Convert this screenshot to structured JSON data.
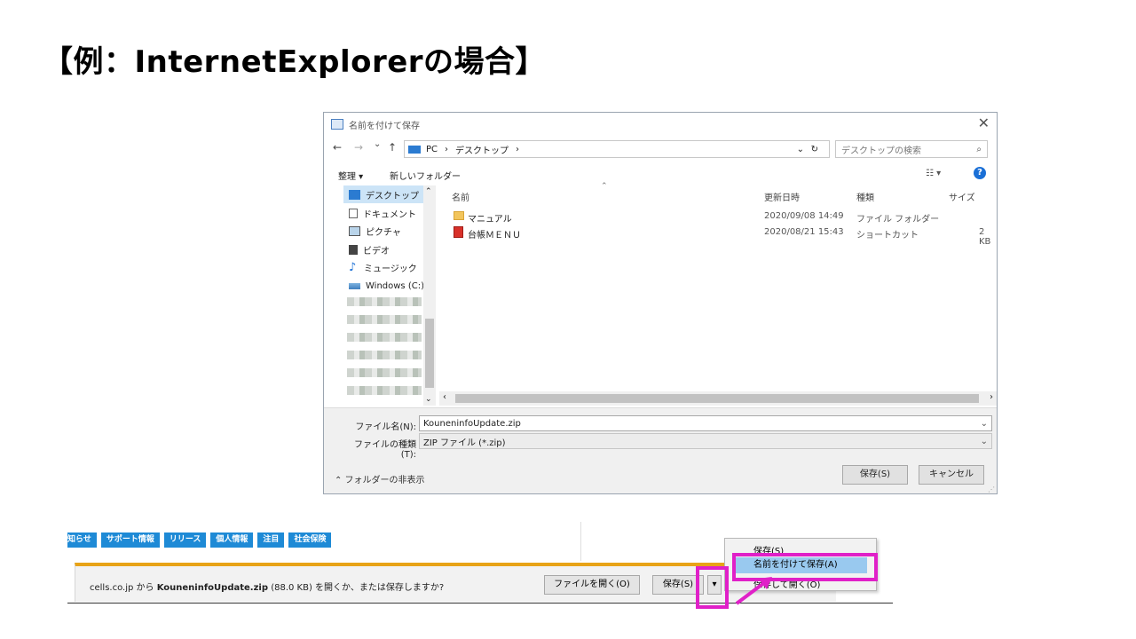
{
  "slide": {
    "title": "【例：InternetExplorerの場合】"
  },
  "dialog": {
    "title": "名前を付けて保存",
    "close": "✕",
    "nav": {
      "back": "←",
      "forward": "→",
      "recent": "⌄",
      "up": "↑",
      "path": [
        "PC",
        "›",
        "デスクトップ",
        "›"
      ],
      "path_dropdown": "⌄",
      "refresh": "↻",
      "search_placeholder": "デスクトップの検索",
      "search_icon": "⌕"
    },
    "toolbar": {
      "organize": "整理 ▾",
      "new_folder": "新しいフォルダー",
      "view": "☷ ▾",
      "help": "?"
    },
    "sidebar": [
      {
        "label": "デスクトップ",
        "icon": "desktop-icon"
      },
      {
        "label": "ドキュメント",
        "icon": "document-icon"
      },
      {
        "label": "ピクチャ",
        "icon": "picture-icon"
      },
      {
        "label": "ビデオ",
        "icon": "video-icon"
      },
      {
        "label": "ミュージック",
        "icon": "music-icon"
      },
      {
        "label": "Windows (C:)",
        "icon": "drive-icon"
      }
    ],
    "columns": {
      "name": "名前",
      "modified": "更新日時",
      "type": "種類",
      "size": "サイズ"
    },
    "files": [
      {
        "name": "マニュアル",
        "modified": "2020/09/08 14:49",
        "type": "ファイル フォルダー",
        "size": ""
      },
      {
        "name": "台帳ＭＥＮＵ",
        "modified": "2020/08/21 15:43",
        "type": "ショートカット",
        "size": "2 KB"
      }
    ],
    "filename_label": "ファイル名(N):",
    "filename_value": "KouneninfoUpdate.zip",
    "filetype_label": "ファイルの種類(T):",
    "filetype_value": "ZIP ファイル (*.zip)",
    "hide_folders": "⌃ フォルダーの非表示",
    "save_button": "保存(S)",
    "cancel_button": "キャンセル"
  },
  "ie": {
    "menu_tabs": [
      "知らせ",
      "サポート情報",
      "リリース",
      "個人情報",
      "注目",
      "社会保険"
    ],
    "message_prefix": "cells.co.jp から ",
    "message_file": "KouneninfoUpdate.zip",
    "message_suffix": " (88.0 KB) を開くか、または保存しますか?",
    "open_button": "ファイルを開く(O)",
    "save_button": "保存(S)",
    "save_dropdown": "▾",
    "menu": {
      "save": "保存(S)",
      "save_as": "名前を付けて保存(A)",
      "save_open": "保存して開く(O)"
    }
  },
  "colors": {
    "highlight": "#e020c8",
    "ie_bar_accent": "#e8a317",
    "tab_blue": "#1e8ad6",
    "menu_hover": "#99c9ef"
  }
}
